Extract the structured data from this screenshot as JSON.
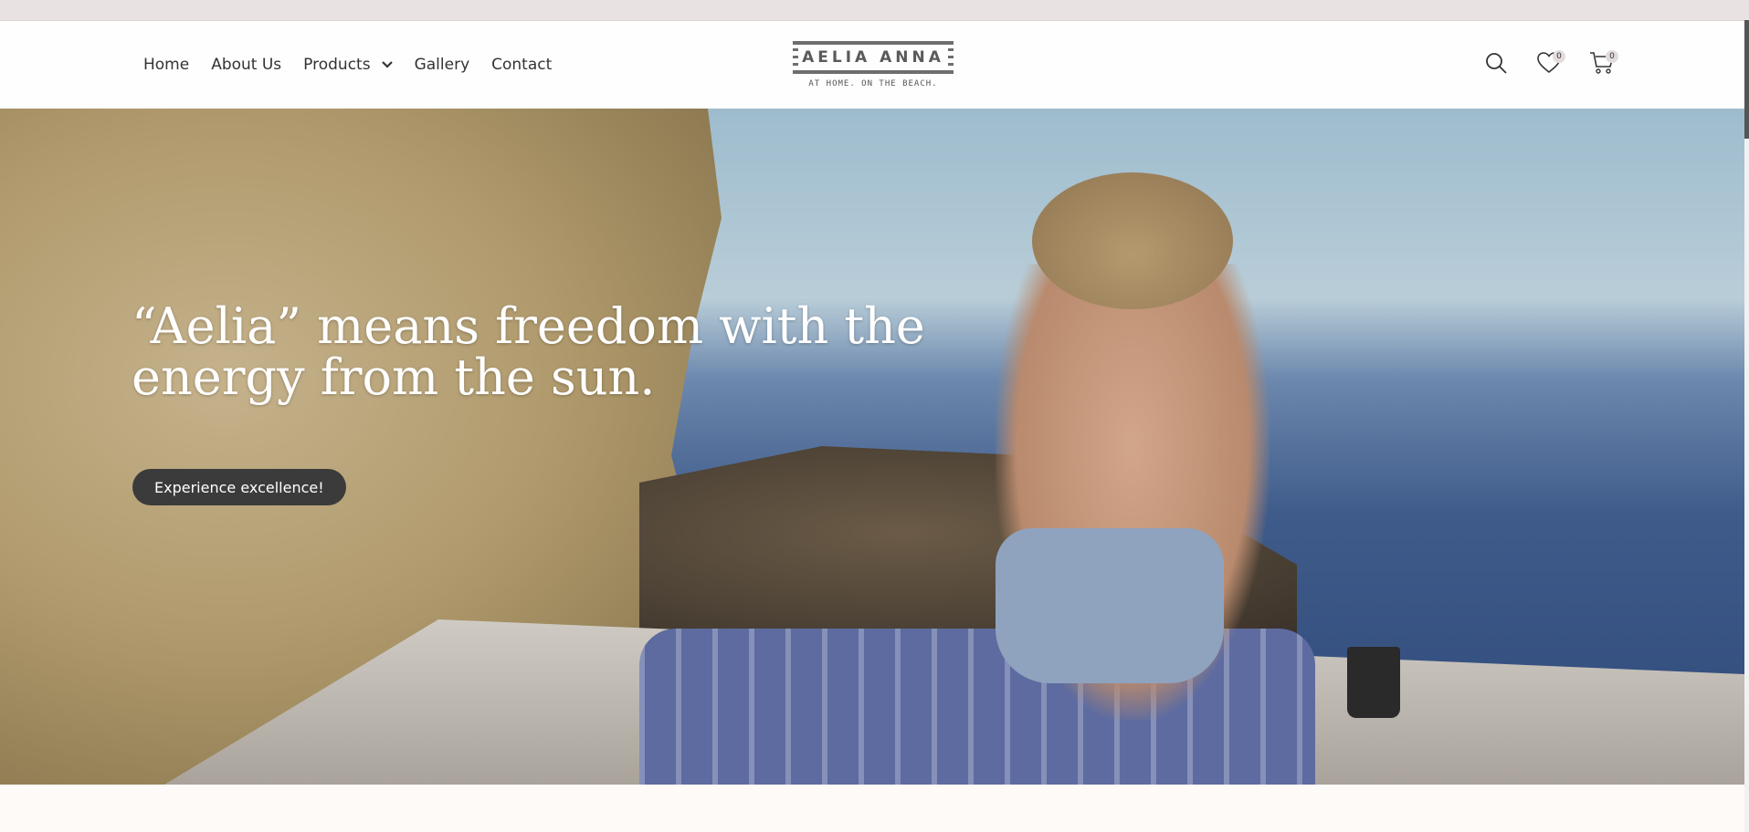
{
  "nav": {
    "items": [
      "Home",
      "About Us",
      "Products",
      "Gallery",
      "Contact"
    ]
  },
  "logo": {
    "name": "AELIA ANNA",
    "tagline": "AT HOME. ON THE BEACH."
  },
  "header_icons": {
    "search": "search-icon",
    "wishlist": "heart-icon",
    "wishlist_count": "0",
    "cart": "cart-icon",
    "cart_count": "0"
  },
  "hero": {
    "title": "“Aelia” means freedom with the energy from the sun.",
    "cta_label": "Experience excellence!"
  },
  "colors": {
    "header_bg": "#fefefe",
    "topbar_bg": "#e8e2e3",
    "cta_bg": "#3b3b3b",
    "text": "#333333"
  }
}
